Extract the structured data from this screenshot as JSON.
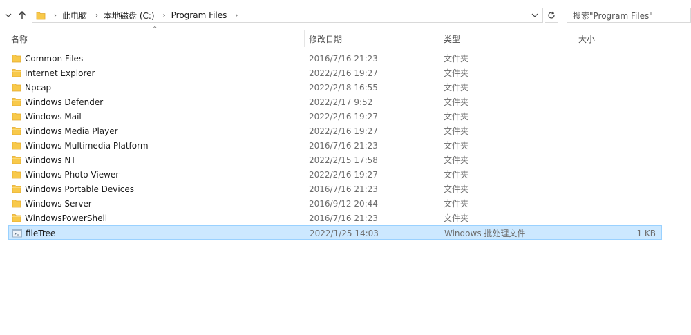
{
  "address_bar": {
    "breadcrumbs": [
      "此电脑",
      "本地磁盘 (C:)",
      "Program Files"
    ]
  },
  "search": {
    "placeholder": "搜索\"Program Files\""
  },
  "columns": {
    "name": "名称",
    "date": "修改日期",
    "type": "类型",
    "size": "大小"
  },
  "files": [
    {
      "name": "Common Files",
      "date": "2016/7/16 21:23",
      "type": "文件夹",
      "size": "",
      "icon": "folder-icon"
    },
    {
      "name": "Internet Explorer",
      "date": "2022/2/16 19:27",
      "type": "文件夹",
      "size": "",
      "icon": "folder-icon"
    },
    {
      "name": "Npcap",
      "date": "2022/2/18 16:55",
      "type": "文件夹",
      "size": "",
      "icon": "folder-icon"
    },
    {
      "name": "Windows Defender",
      "date": "2022/2/17 9:52",
      "type": "文件夹",
      "size": "",
      "icon": "folder-icon"
    },
    {
      "name": "Windows Mail",
      "date": "2022/2/16 19:27",
      "type": "文件夹",
      "size": "",
      "icon": "folder-icon"
    },
    {
      "name": "Windows Media Player",
      "date": "2022/2/16 19:27",
      "type": "文件夹",
      "size": "",
      "icon": "folder-icon"
    },
    {
      "name": "Windows Multimedia Platform",
      "date": "2016/7/16 21:23",
      "type": "文件夹",
      "size": "",
      "icon": "folder-icon"
    },
    {
      "name": "Windows NT",
      "date": "2022/2/15 17:58",
      "type": "文件夹",
      "size": "",
      "icon": "folder-icon"
    },
    {
      "name": "Windows Photo Viewer",
      "date": "2022/2/16 19:27",
      "type": "文件夹",
      "size": "",
      "icon": "folder-icon"
    },
    {
      "name": "Windows Portable Devices",
      "date": "2016/7/16 21:23",
      "type": "文件夹",
      "size": "",
      "icon": "folder-icon"
    },
    {
      "name": "Windows Server",
      "date": "2016/9/12 20:44",
      "type": "文件夹",
      "size": "",
      "icon": "folder-icon"
    },
    {
      "name": "WindowsPowerShell",
      "date": "2016/7/16 21:23",
      "type": "文件夹",
      "size": "",
      "icon": "folder-icon"
    },
    {
      "name": "fileTree",
      "date": "2022/1/25 14:03",
      "type": "Windows 批处理文件",
      "size": "1 KB",
      "icon": "batch-file-icon",
      "selected": true
    }
  ],
  "colors": {
    "selection_bg": "#cce8ff",
    "selection_border": "#99d1ff",
    "folder": "#f8c94a"
  }
}
